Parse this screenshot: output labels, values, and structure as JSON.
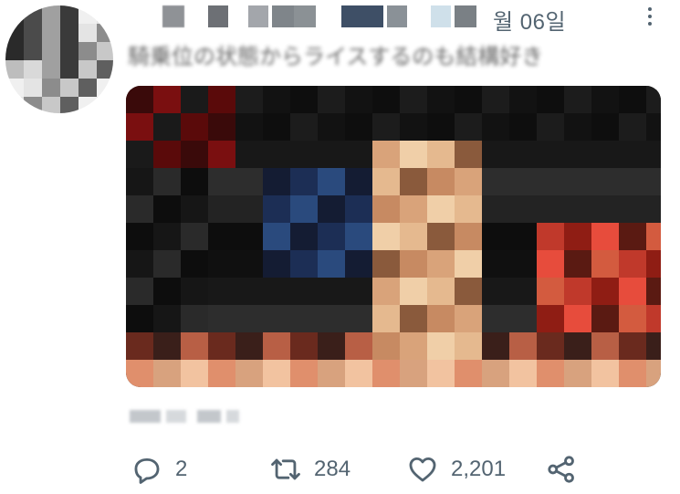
{
  "tweet": {
    "date": "월 06일",
    "text": "騎乗位の状態からライスするのも結構好き",
    "location": "",
    "media_alt": ""
  },
  "actions": {
    "reply_count": "2",
    "retweet_count": "284",
    "like_count": "2,201"
  },
  "icons": {
    "reply": "reply-icon",
    "retweet": "retweet-icon",
    "like": "heart-icon",
    "share": "share-icon",
    "more": "more-icon"
  },
  "colors": {
    "muted": "#536471",
    "text": "#0f1419"
  }
}
